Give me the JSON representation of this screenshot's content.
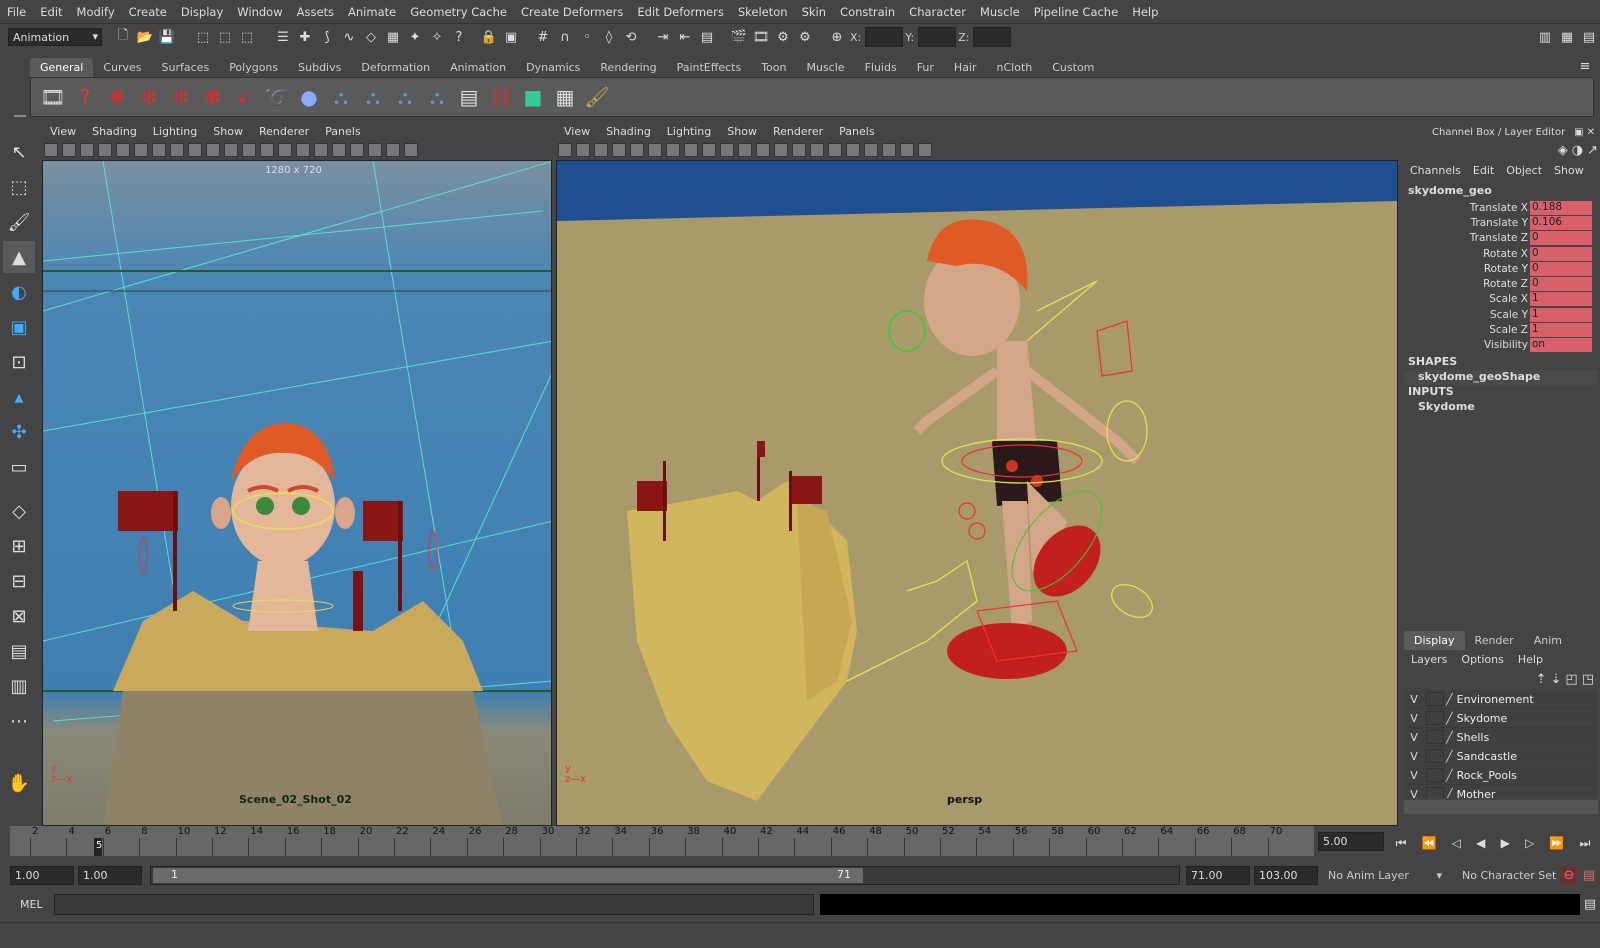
{
  "menus": [
    "File",
    "Edit",
    "Modify",
    "Create",
    "Display",
    "Window",
    "Assets",
    "Animate",
    "Geometry Cache",
    "Create Deformers",
    "Edit Deformers",
    "Skeleton",
    "Skin",
    "Constrain",
    "Character",
    "Muscle",
    "Pipeline Cache",
    "Help"
  ],
  "status_line": {
    "menu_set": "Animation",
    "x_label": "X:",
    "y_label": "Y:",
    "z_label": "Z:"
  },
  "shelf_tabs": [
    "General",
    "Curves",
    "Surfaces",
    "Polygons",
    "Subdivs",
    "Deformation",
    "Animation",
    "Dynamics",
    "Rendering",
    "PaintEffects",
    "Toon",
    "Muscle",
    "Fluids",
    "Fur",
    "Hair",
    "nCloth",
    "Custom"
  ],
  "active_shelf_tab": "General",
  "viewport_menus": [
    "View",
    "Shading",
    "Lighting",
    "Show",
    "Renderer",
    "Panels"
  ],
  "left_viewport": {
    "resolution": "1280 x 720",
    "camera": "Scene_02_Shot_02"
  },
  "right_viewport": {
    "camera": "persp"
  },
  "channel_box": {
    "title": "Channel Box / Layer Editor",
    "menus": [
      "Channels",
      "Edit",
      "Object",
      "Show"
    ],
    "object": "skydome_geo",
    "channels": [
      {
        "name": "Translate X",
        "value": "0.188"
      },
      {
        "name": "Translate Y",
        "value": "0.106"
      },
      {
        "name": "Translate Z",
        "value": "0"
      },
      {
        "name": "Rotate X",
        "value": "0"
      },
      {
        "name": "Rotate Y",
        "value": "0"
      },
      {
        "name": "Rotate Z",
        "value": "0"
      },
      {
        "name": "Scale X",
        "value": "1"
      },
      {
        "name": "Scale Y",
        "value": "1"
      },
      {
        "name": "Scale Z",
        "value": "1"
      },
      {
        "name": "Visibility",
        "value": "on"
      }
    ],
    "shapes_header": "SHAPES",
    "shape": "skydome_geoShape",
    "inputs_header": "INPUTS",
    "input": "Skydome"
  },
  "layer_editor": {
    "tabs": [
      "Display",
      "Render",
      "Anim"
    ],
    "active_tab": "Display",
    "menus": [
      "Layers",
      "Options",
      "Help"
    ],
    "layers": [
      {
        "vis": "V",
        "name": "Environement"
      },
      {
        "vis": "V",
        "name": "Skydome"
      },
      {
        "vis": "V",
        "name": "Shells"
      },
      {
        "vis": "V",
        "name": "Sandcastle"
      },
      {
        "vis": "V",
        "name": "Rock_Pools"
      },
      {
        "vis": "V",
        "name": "Mother"
      }
    ]
  },
  "time_slider": {
    "ticks": [
      "2",
      "4",
      "6",
      "8",
      "10",
      "12",
      "14",
      "16",
      "18",
      "20",
      "22",
      "24",
      "26",
      "28",
      "30",
      "32",
      "34",
      "36",
      "38",
      "40",
      "42",
      "44",
      "46",
      "48",
      "50",
      "52",
      "54",
      "56",
      "58",
      "60",
      "62",
      "64",
      "66",
      "68",
      "70"
    ],
    "current_frame_marker": "5",
    "current_time": "5.00"
  },
  "range_slider": {
    "start_time": "1.00",
    "playback_start": "1.00",
    "range_start_label": "1",
    "range_end_label": "71",
    "playback_end": "71.00",
    "end_time": "103.00",
    "anim_layer": "No Anim Layer",
    "character_set": "No Character Set"
  },
  "command_line": {
    "label": "MEL"
  },
  "icons": {
    "playback": [
      "go-to-start-icon",
      "step-back-key-icon",
      "step-back-frame-icon",
      "play-backward-icon",
      "play-forward-icon",
      "step-forward-frame-icon",
      "step-forward-key-icon",
      "go-to-end-icon"
    ]
  }
}
